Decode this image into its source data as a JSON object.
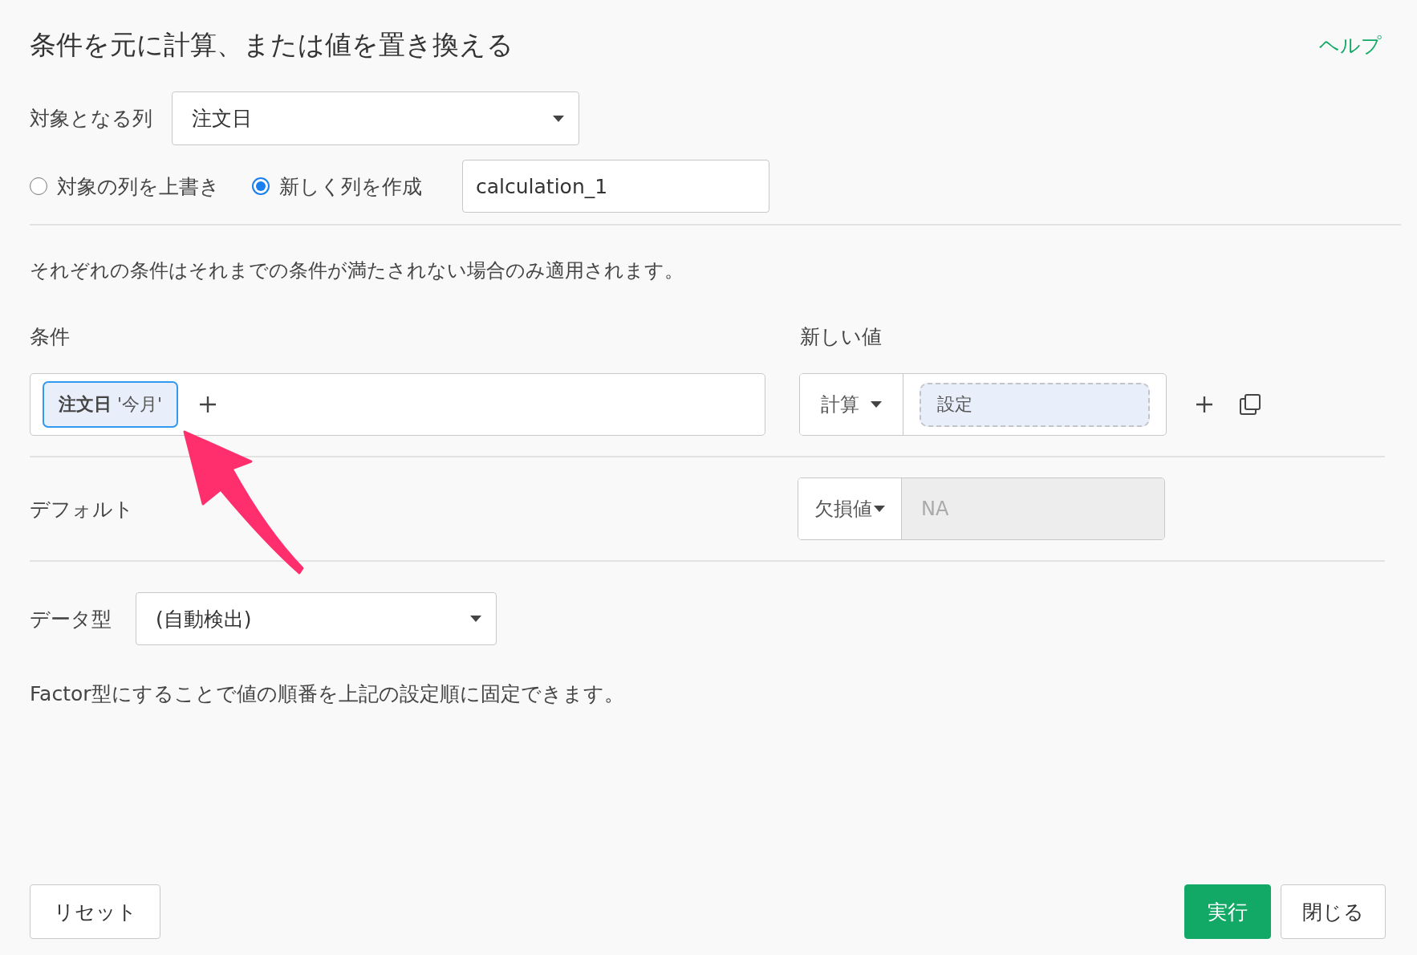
{
  "title": "条件を元に計算、または値を置き換える",
  "help_link": "ヘルプ",
  "target_column": {
    "label": "対象となる列",
    "value": "注文日"
  },
  "output_mode": [
    {
      "label": "対象の列を上書き",
      "selected": false
    },
    {
      "label": "新しく列を作成",
      "selected": true
    }
  ],
  "new_column_name": {
    "value": "calculation_1"
  },
  "note": "それぞれの条件はそれまでの条件が満たされない場合のみ適用されます。",
  "conditions": {
    "heading": "条件",
    "value_heading": "新しい値",
    "rows": [
      {
        "tag": "**注文日** '今月'",
        "value_type": "計算",
        "value_button": "設定"
      }
    ]
  },
  "default": {
    "label": "デフォルト",
    "type": "欠損値",
    "placeholder": "NA"
  },
  "data_type": {
    "label": "データ型",
    "value": "(自動検出)"
  },
  "factor_note": "Factor型にすることで値の順番を上記の設定順に固定できます。",
  "buttons": [
    {
      "label": "リセット",
      "kind": "default"
    },
    {
      "label": "実行",
      "kind": "primary"
    },
    {
      "label": "閉じる",
      "kind": "default"
    }
  ]
}
